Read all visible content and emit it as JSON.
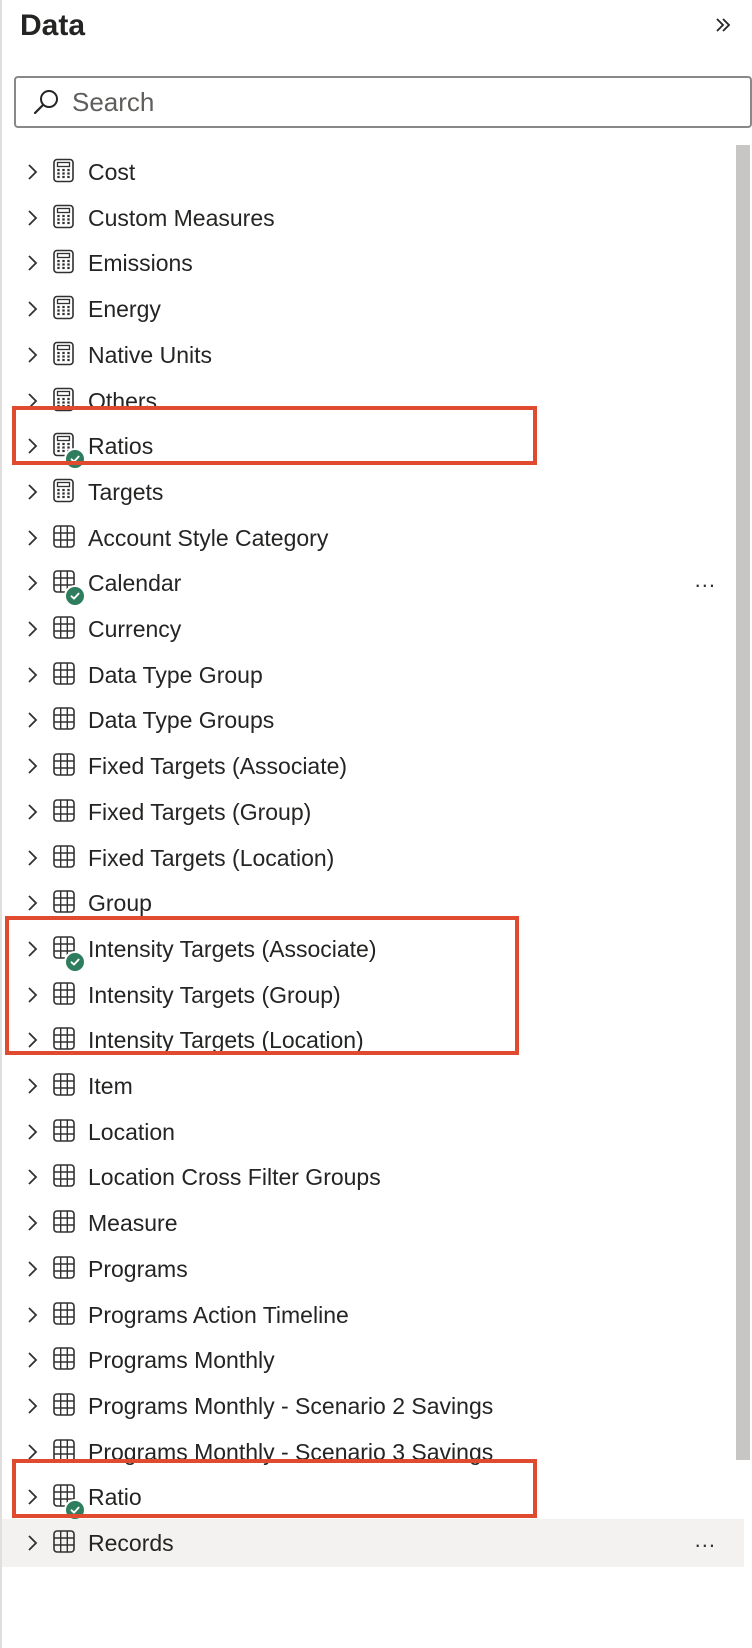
{
  "pane": {
    "title": "Data",
    "collapse_icon": "double-chevron-right-icon"
  },
  "search": {
    "placeholder": "Search",
    "value": "",
    "icon": "search-icon"
  },
  "items": [
    {
      "label": "Cost",
      "kind": "measure",
      "icon": "calculator-icon"
    },
    {
      "label": "Custom Measures",
      "kind": "measure",
      "icon": "calculator-icon"
    },
    {
      "label": "Emissions",
      "kind": "measure",
      "icon": "calculator-icon"
    },
    {
      "label": "Energy",
      "kind": "measure",
      "icon": "calculator-icon"
    },
    {
      "label": "Native Units",
      "kind": "measure",
      "icon": "calculator-icon"
    },
    {
      "label": "Others",
      "kind": "measure",
      "icon": "calculator-icon"
    },
    {
      "label": "Ratios",
      "kind": "measure",
      "icon": "calculator-icon",
      "checked": true,
      "highlighted": true
    },
    {
      "label": "Targets",
      "kind": "measure",
      "icon": "calculator-icon"
    },
    {
      "label": "Account Style Category",
      "kind": "table",
      "icon": "table-icon"
    },
    {
      "label": "Calendar",
      "kind": "table",
      "icon": "table-icon",
      "checked": true,
      "more": "..."
    },
    {
      "label": "Currency",
      "kind": "table",
      "icon": "table-icon"
    },
    {
      "label": "Data Type Group",
      "kind": "table",
      "icon": "table-icon"
    },
    {
      "label": "Data Type Groups",
      "kind": "table",
      "icon": "table-icon"
    },
    {
      "label": "Fixed Targets (Associate)",
      "kind": "table",
      "icon": "table-icon"
    },
    {
      "label": "Fixed Targets (Group)",
      "kind": "table",
      "icon": "table-icon"
    },
    {
      "label": "Fixed Targets (Location)",
      "kind": "table",
      "icon": "table-icon"
    },
    {
      "label": "Group",
      "kind": "table",
      "icon": "table-icon"
    },
    {
      "label": "Intensity Targets (Associate)",
      "kind": "table",
      "icon": "table-icon",
      "checked": true
    },
    {
      "label": "Intensity Targets (Group)",
      "kind": "table",
      "icon": "table-icon"
    },
    {
      "label": "Intensity Targets (Location)",
      "kind": "table",
      "icon": "table-icon"
    },
    {
      "label": "Item",
      "kind": "table",
      "icon": "table-icon"
    },
    {
      "label": "Location",
      "kind": "table",
      "icon": "table-icon"
    },
    {
      "label": "Location Cross Filter Groups",
      "kind": "table",
      "icon": "table-icon"
    },
    {
      "label": "Measure",
      "kind": "table",
      "icon": "table-icon"
    },
    {
      "label": "Programs",
      "kind": "table",
      "icon": "table-icon"
    },
    {
      "label": "Programs Action Timeline",
      "kind": "table",
      "icon": "table-icon"
    },
    {
      "label": "Programs Monthly",
      "kind": "table",
      "icon": "table-icon"
    },
    {
      "label": "Programs Monthly - Scenario 2 Savings",
      "kind": "table",
      "icon": "table-icon"
    },
    {
      "label": "Programs Monthly - Scenario 3 Savings",
      "kind": "table",
      "icon": "table-icon"
    },
    {
      "label": "Ratio",
      "kind": "table",
      "icon": "table-icon",
      "checked": true
    },
    {
      "label": "Records",
      "kind": "table",
      "icon": "table-icon",
      "hovered": true,
      "more": "..."
    }
  ],
  "colors": {
    "highlight": "#e04a2f",
    "check_badge": "#2e7d5e",
    "hover_row": "#f3f2f1"
  }
}
